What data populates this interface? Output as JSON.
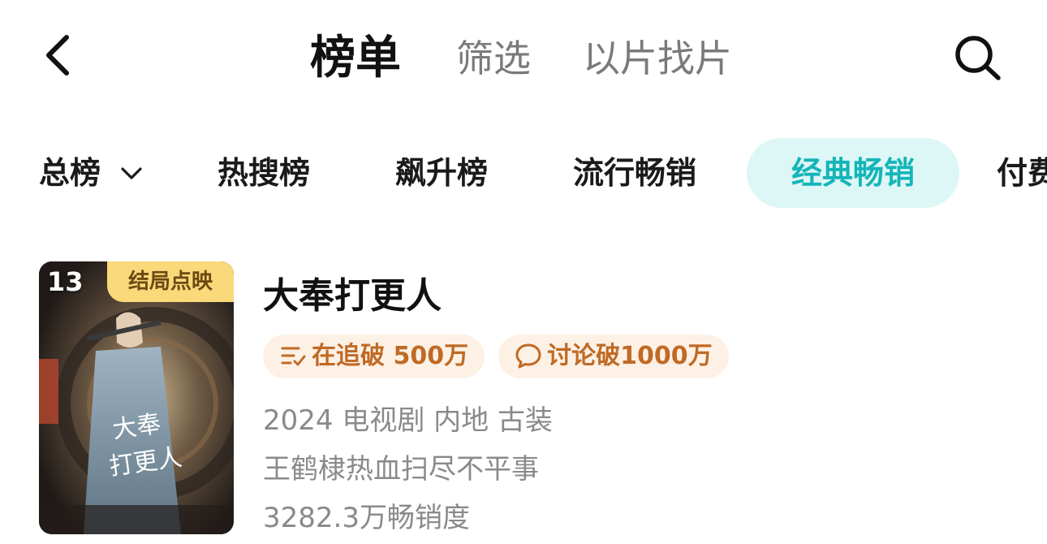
{
  "header": {
    "back_icon": "chevron-left-icon",
    "tabs": [
      {
        "label": "榜单",
        "active": true
      },
      {
        "label": "筛选",
        "active": false
      },
      {
        "label": "以片找片",
        "active": false
      }
    ],
    "search_icon": "search-icon"
  },
  "categories": [
    {
      "label": "总榜",
      "has_dropdown": true
    },
    {
      "label": "热搜榜"
    },
    {
      "label": "飙升榜"
    },
    {
      "label": "流行畅销"
    },
    {
      "label": "经典畅销",
      "active": true
    },
    {
      "label": "付费"
    }
  ],
  "colors": {
    "accent": "#14b5b8",
    "accent_bg": "#ddf6f6",
    "tag_text": "#c06a25",
    "tag_bg": "#fdf1e6",
    "badge_bg": "#f9d97a"
  },
  "item": {
    "rank": "13",
    "badge": "结局点映",
    "title": "大奉打更人",
    "tags": [
      {
        "icon": "list-check-icon",
        "label": "在追破 500万"
      },
      {
        "icon": "chat-bubble-icon",
        "label": "讨论破1000万"
      }
    ],
    "meta": "2024 电视剧 内地 古装",
    "description": "王鹤棣热血扫尽不平事",
    "sales": "3282.3万畅销度"
  }
}
